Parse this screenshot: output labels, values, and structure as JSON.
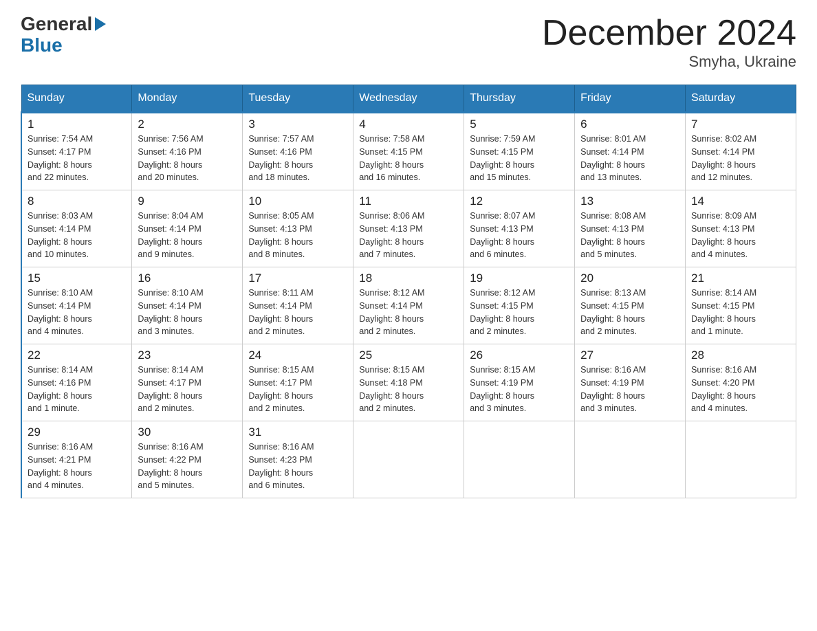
{
  "header": {
    "title": "December 2024",
    "subtitle": "Smyha, Ukraine",
    "logo_general": "General",
    "logo_blue": "Blue"
  },
  "columns": [
    "Sunday",
    "Monday",
    "Tuesday",
    "Wednesday",
    "Thursday",
    "Friday",
    "Saturday"
  ],
  "weeks": [
    [
      {
        "day": "1",
        "sunrise": "Sunrise: 7:54 AM",
        "sunset": "Sunset: 4:17 PM",
        "daylight": "Daylight: 8 hours",
        "minutes": "and 22 minutes."
      },
      {
        "day": "2",
        "sunrise": "Sunrise: 7:56 AM",
        "sunset": "Sunset: 4:16 PM",
        "daylight": "Daylight: 8 hours",
        "minutes": "and 20 minutes."
      },
      {
        "day": "3",
        "sunrise": "Sunrise: 7:57 AM",
        "sunset": "Sunset: 4:16 PM",
        "daylight": "Daylight: 8 hours",
        "minutes": "and 18 minutes."
      },
      {
        "day": "4",
        "sunrise": "Sunrise: 7:58 AM",
        "sunset": "Sunset: 4:15 PM",
        "daylight": "Daylight: 8 hours",
        "minutes": "and 16 minutes."
      },
      {
        "day": "5",
        "sunrise": "Sunrise: 7:59 AM",
        "sunset": "Sunset: 4:15 PM",
        "daylight": "Daylight: 8 hours",
        "minutes": "and 15 minutes."
      },
      {
        "day": "6",
        "sunrise": "Sunrise: 8:01 AM",
        "sunset": "Sunset: 4:14 PM",
        "daylight": "Daylight: 8 hours",
        "minutes": "and 13 minutes."
      },
      {
        "day": "7",
        "sunrise": "Sunrise: 8:02 AM",
        "sunset": "Sunset: 4:14 PM",
        "daylight": "Daylight: 8 hours",
        "minutes": "and 12 minutes."
      }
    ],
    [
      {
        "day": "8",
        "sunrise": "Sunrise: 8:03 AM",
        "sunset": "Sunset: 4:14 PM",
        "daylight": "Daylight: 8 hours",
        "minutes": "and 10 minutes."
      },
      {
        "day": "9",
        "sunrise": "Sunrise: 8:04 AM",
        "sunset": "Sunset: 4:14 PM",
        "daylight": "Daylight: 8 hours",
        "minutes": "and 9 minutes."
      },
      {
        "day": "10",
        "sunrise": "Sunrise: 8:05 AM",
        "sunset": "Sunset: 4:13 PM",
        "daylight": "Daylight: 8 hours",
        "minutes": "and 8 minutes."
      },
      {
        "day": "11",
        "sunrise": "Sunrise: 8:06 AM",
        "sunset": "Sunset: 4:13 PM",
        "daylight": "Daylight: 8 hours",
        "minutes": "and 7 minutes."
      },
      {
        "day": "12",
        "sunrise": "Sunrise: 8:07 AM",
        "sunset": "Sunset: 4:13 PM",
        "daylight": "Daylight: 8 hours",
        "minutes": "and 6 minutes."
      },
      {
        "day": "13",
        "sunrise": "Sunrise: 8:08 AM",
        "sunset": "Sunset: 4:13 PM",
        "daylight": "Daylight: 8 hours",
        "minutes": "and 5 minutes."
      },
      {
        "day": "14",
        "sunrise": "Sunrise: 8:09 AM",
        "sunset": "Sunset: 4:13 PM",
        "daylight": "Daylight: 8 hours",
        "minutes": "and 4 minutes."
      }
    ],
    [
      {
        "day": "15",
        "sunrise": "Sunrise: 8:10 AM",
        "sunset": "Sunset: 4:14 PM",
        "daylight": "Daylight: 8 hours",
        "minutes": "and 4 minutes."
      },
      {
        "day": "16",
        "sunrise": "Sunrise: 8:10 AM",
        "sunset": "Sunset: 4:14 PM",
        "daylight": "Daylight: 8 hours",
        "minutes": "and 3 minutes."
      },
      {
        "day": "17",
        "sunrise": "Sunrise: 8:11 AM",
        "sunset": "Sunset: 4:14 PM",
        "daylight": "Daylight: 8 hours",
        "minutes": "and 2 minutes."
      },
      {
        "day": "18",
        "sunrise": "Sunrise: 8:12 AM",
        "sunset": "Sunset: 4:14 PM",
        "daylight": "Daylight: 8 hours",
        "minutes": "and 2 minutes."
      },
      {
        "day": "19",
        "sunrise": "Sunrise: 8:12 AM",
        "sunset": "Sunset: 4:15 PM",
        "daylight": "Daylight: 8 hours",
        "minutes": "and 2 minutes."
      },
      {
        "day": "20",
        "sunrise": "Sunrise: 8:13 AM",
        "sunset": "Sunset: 4:15 PM",
        "daylight": "Daylight: 8 hours",
        "minutes": "and 2 minutes."
      },
      {
        "day": "21",
        "sunrise": "Sunrise: 8:14 AM",
        "sunset": "Sunset: 4:15 PM",
        "daylight": "Daylight: 8 hours",
        "minutes": "and 1 minute."
      }
    ],
    [
      {
        "day": "22",
        "sunrise": "Sunrise: 8:14 AM",
        "sunset": "Sunset: 4:16 PM",
        "daylight": "Daylight: 8 hours",
        "minutes": "and 1 minute."
      },
      {
        "day": "23",
        "sunrise": "Sunrise: 8:14 AM",
        "sunset": "Sunset: 4:17 PM",
        "daylight": "Daylight: 8 hours",
        "minutes": "and 2 minutes."
      },
      {
        "day": "24",
        "sunrise": "Sunrise: 8:15 AM",
        "sunset": "Sunset: 4:17 PM",
        "daylight": "Daylight: 8 hours",
        "minutes": "and 2 minutes."
      },
      {
        "day": "25",
        "sunrise": "Sunrise: 8:15 AM",
        "sunset": "Sunset: 4:18 PM",
        "daylight": "Daylight: 8 hours",
        "minutes": "and 2 minutes."
      },
      {
        "day": "26",
        "sunrise": "Sunrise: 8:15 AM",
        "sunset": "Sunset: 4:19 PM",
        "daylight": "Daylight: 8 hours",
        "minutes": "and 3 minutes."
      },
      {
        "day": "27",
        "sunrise": "Sunrise: 8:16 AM",
        "sunset": "Sunset: 4:19 PM",
        "daylight": "Daylight: 8 hours",
        "minutes": "and 3 minutes."
      },
      {
        "day": "28",
        "sunrise": "Sunrise: 8:16 AM",
        "sunset": "Sunset: 4:20 PM",
        "daylight": "Daylight: 8 hours",
        "minutes": "and 4 minutes."
      }
    ],
    [
      {
        "day": "29",
        "sunrise": "Sunrise: 8:16 AM",
        "sunset": "Sunset: 4:21 PM",
        "daylight": "Daylight: 8 hours",
        "minutes": "and 4 minutes."
      },
      {
        "day": "30",
        "sunrise": "Sunrise: 8:16 AM",
        "sunset": "Sunset: 4:22 PM",
        "daylight": "Daylight: 8 hours",
        "minutes": "and 5 minutes."
      },
      {
        "day": "31",
        "sunrise": "Sunrise: 8:16 AM",
        "sunset": "Sunset: 4:23 PM",
        "daylight": "Daylight: 8 hours",
        "minutes": "and 6 minutes."
      },
      null,
      null,
      null,
      null
    ]
  ]
}
